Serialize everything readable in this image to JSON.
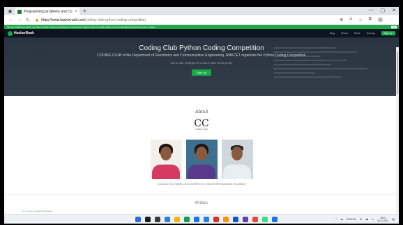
{
  "browser": {
    "tab_title": "Programming problems and Co",
    "tab_close": "×",
    "new_tab": "+",
    "url_host": "https://www.hackerrank.com",
    "url_path": "/coding-club-python-coding-competition",
    "window_controls": [
      "—",
      "▢",
      "✕"
    ]
  },
  "notice": {
    "text": "We use cookies to ensure you have the best browsing experience on our website. Please read our cookie policy for more information about how we use cookies.",
    "ok": "Ok"
  },
  "site": {
    "logo": "HackerRank",
    "nav": [
      "Blog",
      "Prizes",
      "Rules",
      "Scoring"
    ],
    "signup": "Sign Up"
  },
  "hero": {
    "title": "Coding Club Python Coding Competition",
    "subtitle": "CODING CLUB of the Department of Electronics and Communication Engineering, RMKCET organizes the Python Coding Competition",
    "date": "Nov 8, 2021, 09:30 pm IST to Nov 9, 2021, 09:30 pm IST",
    "signup": "Sign Up"
  },
  "about": {
    "title": "About",
    "logo_text": "CC",
    "logo_caption": "CODING CLUB",
    "caption": "Coordinators: Mrs.R.SWAPNA, Mrs.K.SANDHIYA | Dr.L.SANDHIYA PRIYADHARSHINI, Mr.RAJESH M"
  },
  "prizes": {
    "title": "Prizes",
    "line": "Top 3 winners will get E-Certificate"
  },
  "taskbar": {
    "icon_colors": [
      "#2b6fd6",
      "#1d1d1d",
      "#3a3a3a",
      "#2a7de1",
      "#f4b400",
      "#0f9d58",
      "#1a73e8",
      "#2a7de1",
      "#d93025",
      "#f29900",
      "#0b57d0",
      "#673ab7",
      "#e84a32",
      "#3ddc84",
      "#1a73e8"
    ],
    "tray_lang": "ENG IN",
    "time": "18:01",
    "date": "20-11-2021"
  }
}
